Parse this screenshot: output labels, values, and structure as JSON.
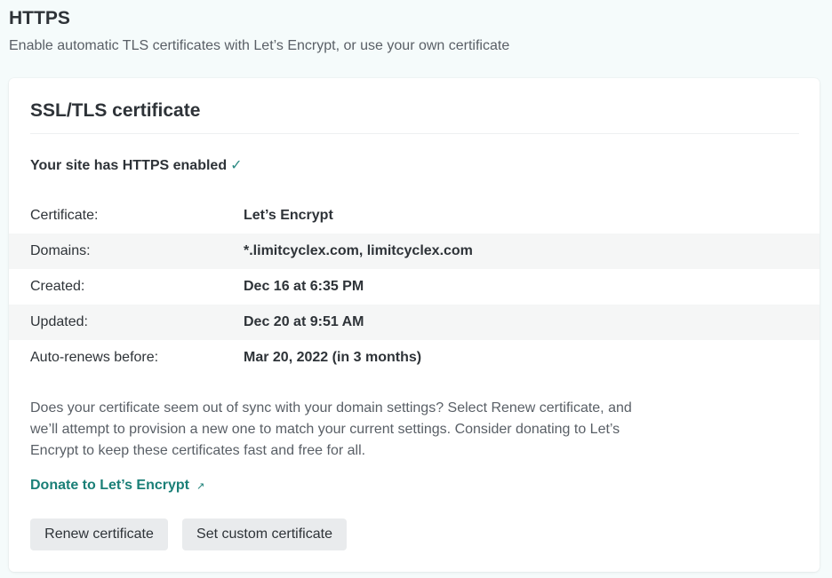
{
  "header": {
    "title": "HTTPS",
    "subtitle": "Enable automatic TLS certificates with Let’s Encrypt, or use your own certificate"
  },
  "card": {
    "title": "SSL/TLS certificate",
    "status_text": "Your site has HTTPS enabled",
    "status_icon": "✓",
    "rows": [
      {
        "label": "Certificate:",
        "value": "Let’s Encrypt"
      },
      {
        "label": "Domains:",
        "value": "*.limitcyclex.com, limitcyclex.com"
      },
      {
        "label": "Created:",
        "value": "Dec 16 at 6:35 PM"
      },
      {
        "label": "Updated:",
        "value": "Dec 20 at 9:51 AM"
      },
      {
        "label": "Auto-renews before:",
        "value": "Mar 20, 2022 (in 3 months)"
      }
    ],
    "help_text": "Does your certificate seem out of sync with your domain settings? Select Renew certificate, and we’ll attempt to provision a new one to match your current settings. Consider donating to Let’s Encrypt to keep these certificates fast and free for all.",
    "donate_link": "Donate to Let’s Encrypt",
    "donate_icon": "↗",
    "buttons": {
      "renew": "Renew certificate",
      "custom": "Set custom certificate"
    }
  },
  "colors": {
    "accent": "#1a7f77",
    "background": "#f5fbfb",
    "button_bg": "#e9ebed"
  }
}
